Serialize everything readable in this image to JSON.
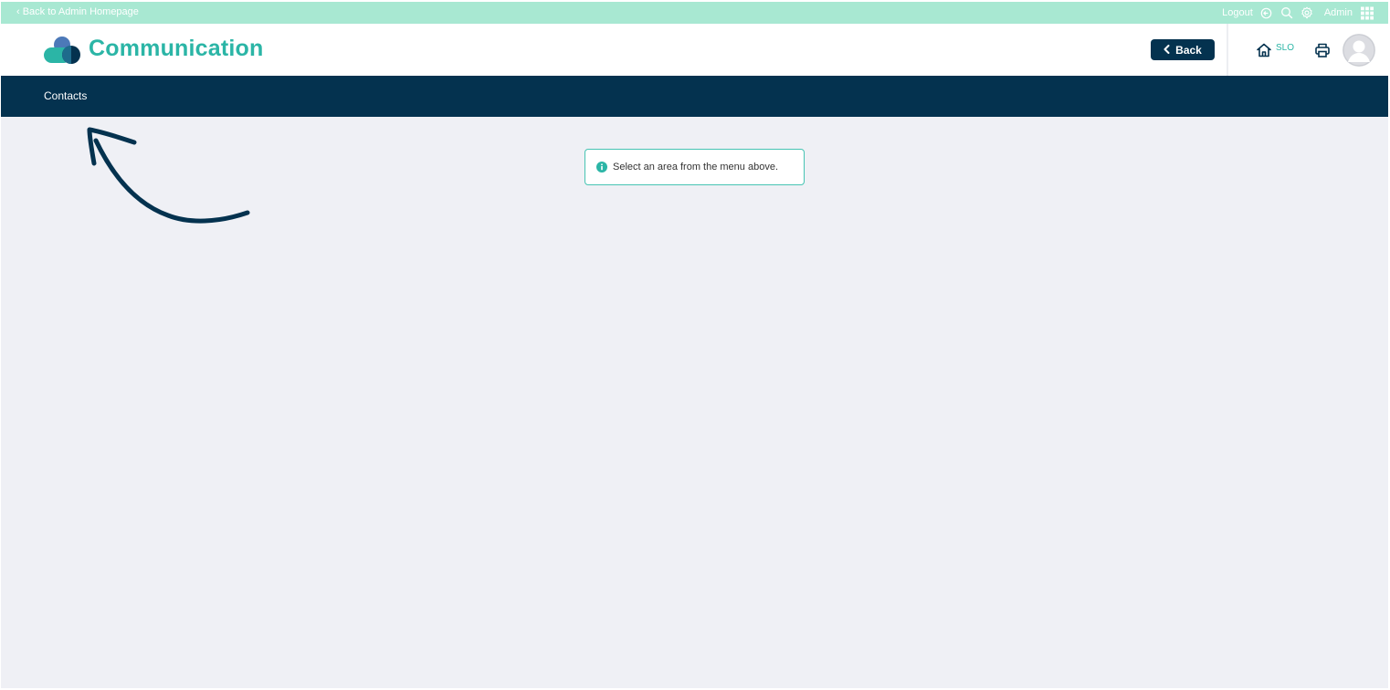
{
  "topbar": {
    "back_label": "‹ Back to Admin Homepage",
    "logout_label": "Logout",
    "user_label": "Admin"
  },
  "header": {
    "title": "Communication",
    "back_button": "Back",
    "school_code": "SLO"
  },
  "nav": {
    "items": [
      {
        "label": "Contacts"
      }
    ]
  },
  "message": {
    "text": "Select an area from the menu above."
  },
  "colors": {
    "topbar": "#a8e8d2",
    "navy": "#04324f",
    "teal": "#2bb5a6",
    "background": "#eff0f5"
  },
  "icons": [
    "logout-icon",
    "search-icon",
    "settings-icon",
    "apps-grid-icon",
    "home-icon",
    "print-icon",
    "avatar",
    "info-icon",
    "arrow-annotation"
  ]
}
